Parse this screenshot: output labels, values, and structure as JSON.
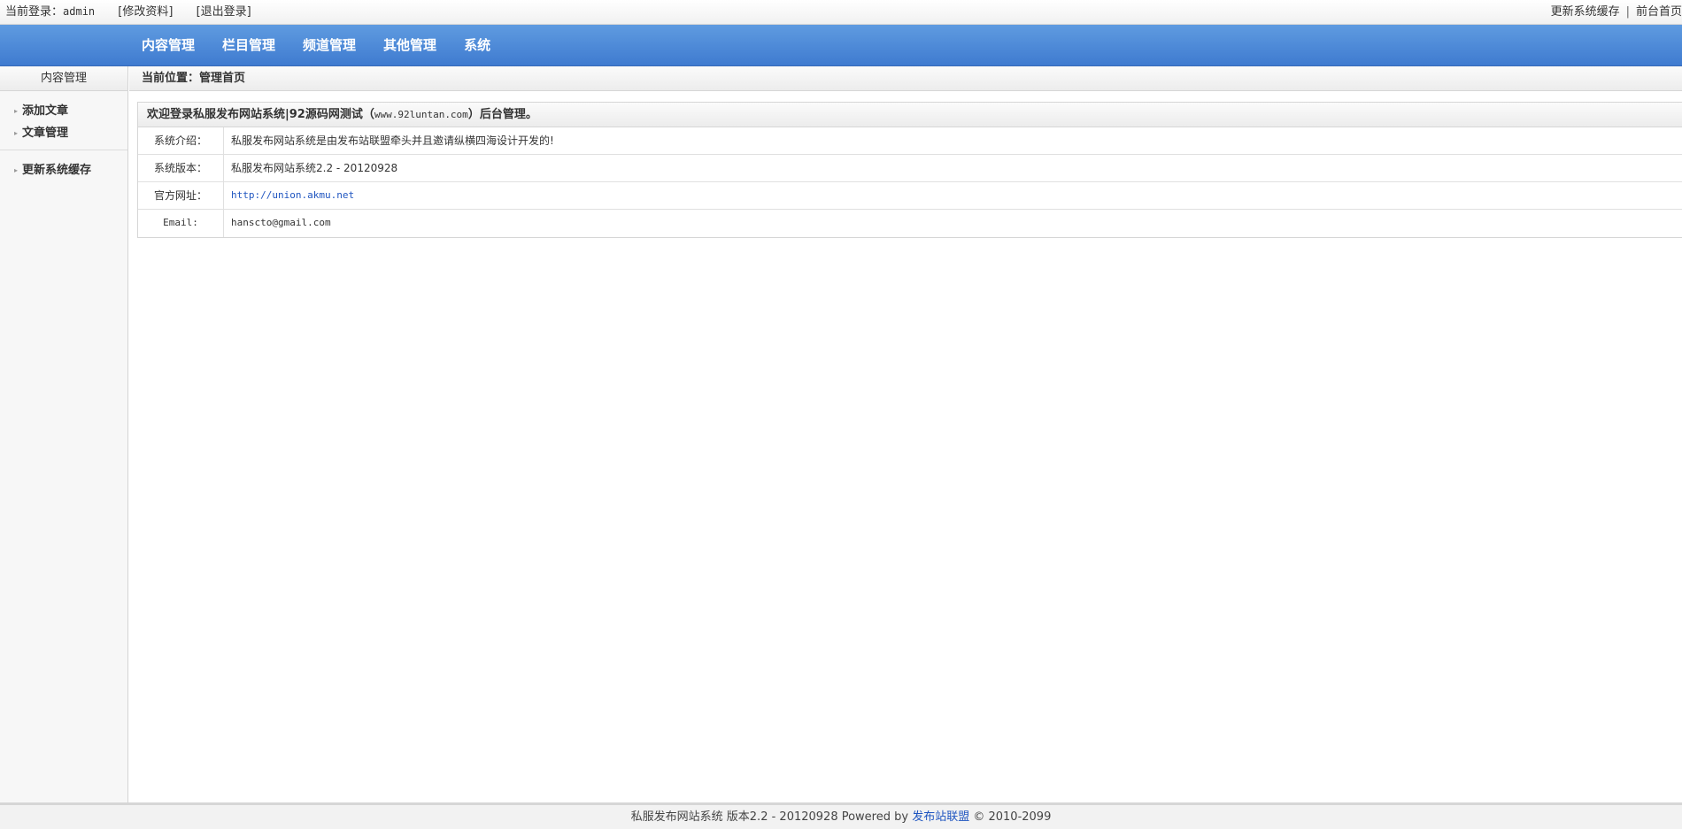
{
  "topbar": {
    "login_label": "当前登录：",
    "username": "admin",
    "edit_profile": "[修改资料]",
    "logout": "[退出登录]",
    "update_cache": "更新系统缓存",
    "separator": "|",
    "front_home": "前台首页"
  },
  "nav": {
    "items": [
      {
        "label": "内容管理"
      },
      {
        "label": "栏目管理"
      },
      {
        "label": "频道管理"
      },
      {
        "label": "其他管理"
      },
      {
        "label": "系统"
      }
    ]
  },
  "sidebar": {
    "title": "内容管理",
    "items": [
      {
        "label": "添加文章"
      },
      {
        "label": "文章管理"
      },
      {
        "label": "更新系统缓存"
      }
    ]
  },
  "breadcrumb": {
    "label": "当前位置：",
    "current": "管理首页"
  },
  "panel": {
    "title_prefix": "欢迎登录私服发布网站系统|92源码网测试（",
    "title_site": "www.92luntan.com",
    "title_suffix": "）后台管理。",
    "rows": [
      {
        "key": "系统介绍：",
        "value": "私服发布网站系统是由发布站联盟牵头并且邀请纵横四海设计开发的!"
      },
      {
        "key": "系统版本：",
        "value": "私服发布网站系统2.2 - 20120928"
      },
      {
        "key": "官方网址：",
        "value": "http://union.akmu.net"
      },
      {
        "key": "Email:",
        "value": "hanscto@gmail.com"
      }
    ]
  },
  "footer": {
    "text_before": "私服发布网站系统 版本2.2 - 20120928 Powered by ",
    "link": "发布站联盟",
    "text_after": " © 2010-2099"
  },
  "colors": {
    "nav_top": "#5f9be0",
    "nav_bottom": "#3f7bd0",
    "link": "#1f55c0"
  },
  "icons": {
    "sidebar_arrow": "caret-right-icon"
  }
}
